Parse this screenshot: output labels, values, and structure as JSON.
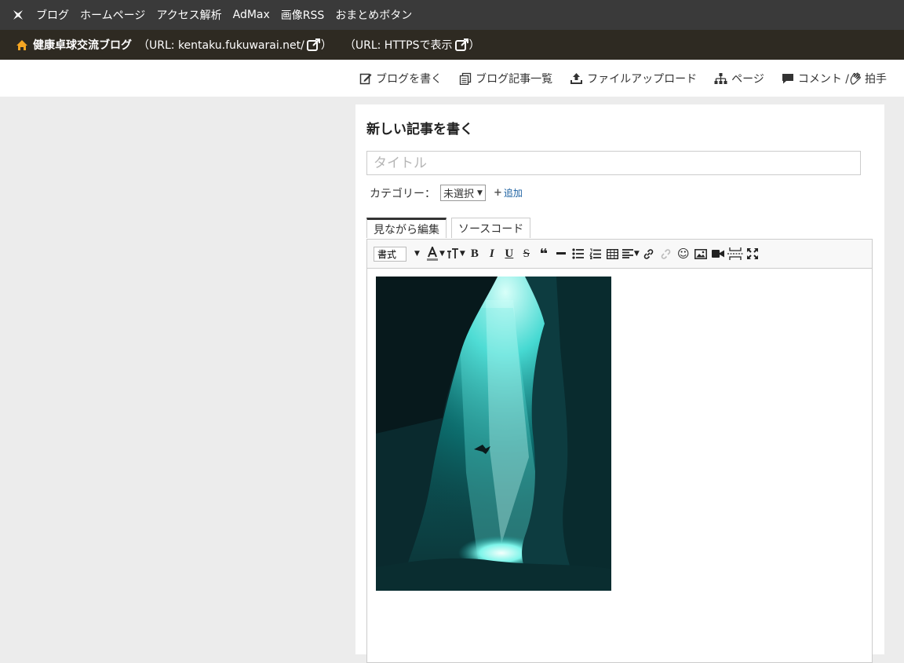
{
  "topnav": {
    "items": [
      "ブログ",
      "ホームページ",
      "アクセス解析",
      "AdMax",
      "画像RSS",
      "おまとめボタン"
    ]
  },
  "blogbar": {
    "blog_name": "健康卓球交流ブログ",
    "url_text": "（URL: kentaku.fukuwarai.net/",
    "url_close": "）",
    "https_text": "（URL: HTTPSで表示",
    "https_close": "）"
  },
  "actions": {
    "write": "ブログを書く",
    "list": "ブログ記事一覧",
    "upload": "ファイルアップロード",
    "page": "ページ",
    "comment": "コメント / ",
    "clap": "拍手"
  },
  "editor": {
    "heading": "新しい記事を書く",
    "title_placeholder": "タイトル",
    "category_label": "カテゴリー：",
    "category_value": "未選択",
    "add_label": "追加",
    "tab_visual": "見ながら編集",
    "tab_source": "ソースコード",
    "format_label": "書式"
  },
  "colors": {
    "topbar": "#3a3a3a",
    "blogbar": "#2e2a22",
    "accent_home": "#f5a623",
    "link": "#1a5fa0"
  }
}
